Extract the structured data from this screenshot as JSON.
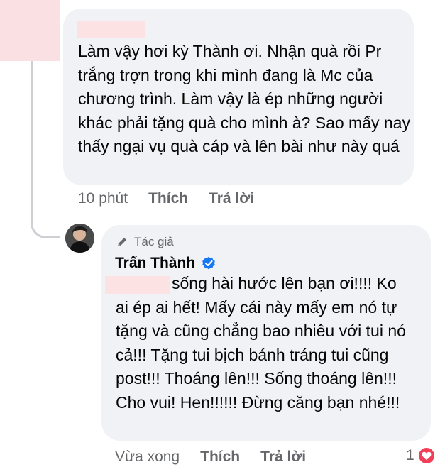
{
  "comment1": {
    "text": "Làm vậy hơi kỳ Thành ơi. Nhận quà rồi Pr trắng trợn trong khi mình đang là Mc của chương trình. Làm vậy là ép những người khác phải tặng quà cho mình à? Sao mấy nay thấy ngại vụ quà cáp và lên bài như này quá",
    "time": "10 phút",
    "like_label": "Thích",
    "reply_label": "Trả lời"
  },
  "comment2": {
    "author_badge": "Tác giả",
    "author_name": "Trấn Thành",
    "text_first_line": "sống hài hước lên bạn ơi!!!! Ko",
    "text_rest": "ai ép ai hết! Mấy cái này mấy em nó tự tặng và cũng chẳng bao nhiêu với tui nó cả!!! Tặng tui bịch bánh tráng tui cũng post!!! Thoáng lên!!! Sống thoáng lên!!! Cho vui! Hen!!!!!! Đừng căng bạn nhé!!!",
    "time": "Vừa xong",
    "like_label": "Thích",
    "reply_label": "Trả lời",
    "reaction_count": "1",
    "reaction_icon": "heart-icon"
  },
  "colors": {
    "bubble": "#f0f2f5",
    "meta_text": "#65676b",
    "verified": "#1877f2",
    "heart": "#f33e58",
    "redaction": "#fde2e4"
  }
}
